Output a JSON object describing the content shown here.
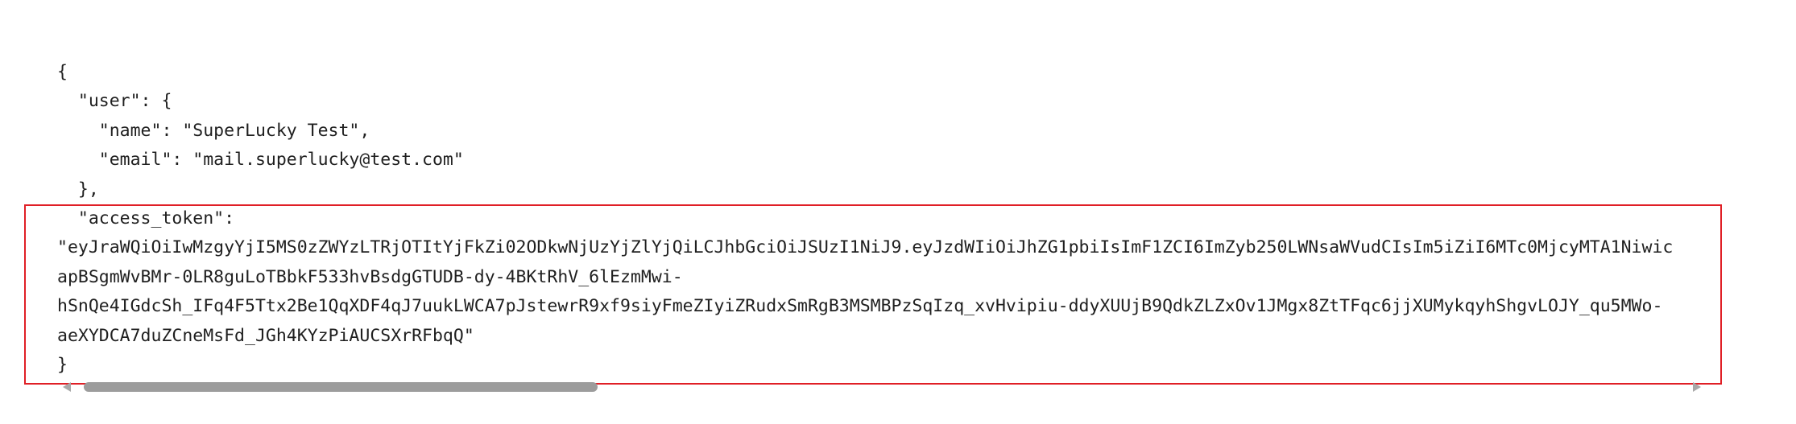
{
  "code_lines": [
    "{",
    "  \"user\": {",
    "    \"name\": \"SuperLucky Test\",",
    "    \"email\": \"mail.superlucky@test.com\"",
    "  },",
    "  \"access_token\":",
    "\"eyJraWQiOiIwMzgyYjI5MS0zZWYzLTRjOTItYjFkZi02ODkwNjUzYjZlYjQiLCJhbGciOiJSUzI1NiJ9.eyJzdWIiOiJhZG1pbiIsImF1ZCI6ImZyb250LWNsaWVudCIsIm5iZiI6MTc0MjcyMTA1Niwic",
    "apBSgmWvBMr-0LR8guLoTBbkF533hvBsdgGTUDB-dy-4BKtRhV_6lEzmMwi-",
    "hSnQe4IGdcSh_IFq4F5Ttx2Be1QqXDF4qJ7uukLWCA7pJstewrR9xf9siyFmeZIyiZRudxSmRgB3MSMBPzSqIzq_xvHvipiu-ddyXUUjB9QdkZLZxOv1JMgx8ZtTFqc6jjXUMykqyhShgvLOJY_qu5MWo-",
    "aeXYDCA7duZCneMsFd_JGh4KYzPiAUCSXrRFbqQ\"",
    "}"
  ]
}
